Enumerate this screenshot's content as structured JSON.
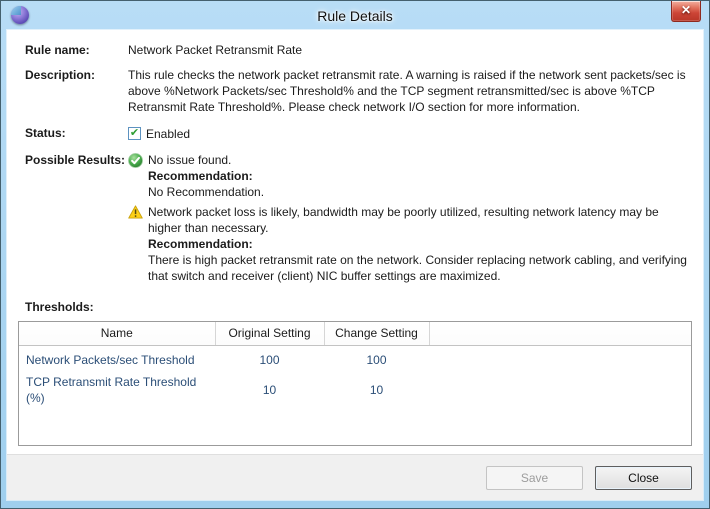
{
  "window": {
    "title": "Rule Details",
    "close_glyph": "✕"
  },
  "fields": {
    "rule_name_label": "Rule name:",
    "rule_name": "Network Packet Retransmit Rate",
    "description_label": "Description:",
    "description": "This rule checks the network packet retransmit rate. A warning is raised if the network sent packets/sec is above %Network Packets/sec Threshold% and the TCP segment retransmitted/sec is above %TCP Retransmit Rate Threshold%. Please check network I/O section for more information.",
    "status_label": "Status:",
    "status_checkbox_label": "Enabled",
    "status_checked_glyph": "✔",
    "possible_results_label": "Possible Results:"
  },
  "results": [
    {
      "icon": "success-icon",
      "text": "No issue found.",
      "recommendation_label": "Recommendation:",
      "recommendation": "No Recommendation."
    },
    {
      "icon": "warning-icon",
      "text": "Network packet loss is likely, bandwidth may be poorly utilized, resulting network latency may be higher than necessary.",
      "recommendation_label": "Recommendation:",
      "recommendation": "There is high packet retransmit rate on the network. Consider replacing network cabling, and verifying that switch and receiver (client) NIC buffer settings are maximized."
    }
  ],
  "thresholds": {
    "label": "Thresholds:",
    "columns": [
      "Name",
      "Original Setting",
      "Change Setting"
    ],
    "rows": [
      {
        "name": "Network Packets/sec Threshold",
        "original": "100",
        "change": "100"
      },
      {
        "name": "TCP Retransmit Rate Threshold (%)",
        "original": "10",
        "change": "10"
      }
    ]
  },
  "footer": {
    "save_label": "Save",
    "close_label": "Close"
  },
  "colors": {
    "titlebar_blue": "#a9d7f2",
    "frame_blue": "#a6d3ee",
    "close_red": "#cc4536",
    "link_blue": "#2b4e77",
    "success_green": "#3aa43a",
    "warning_yellow": "#fdd017",
    "footer_gray": "#f0f0f0"
  }
}
